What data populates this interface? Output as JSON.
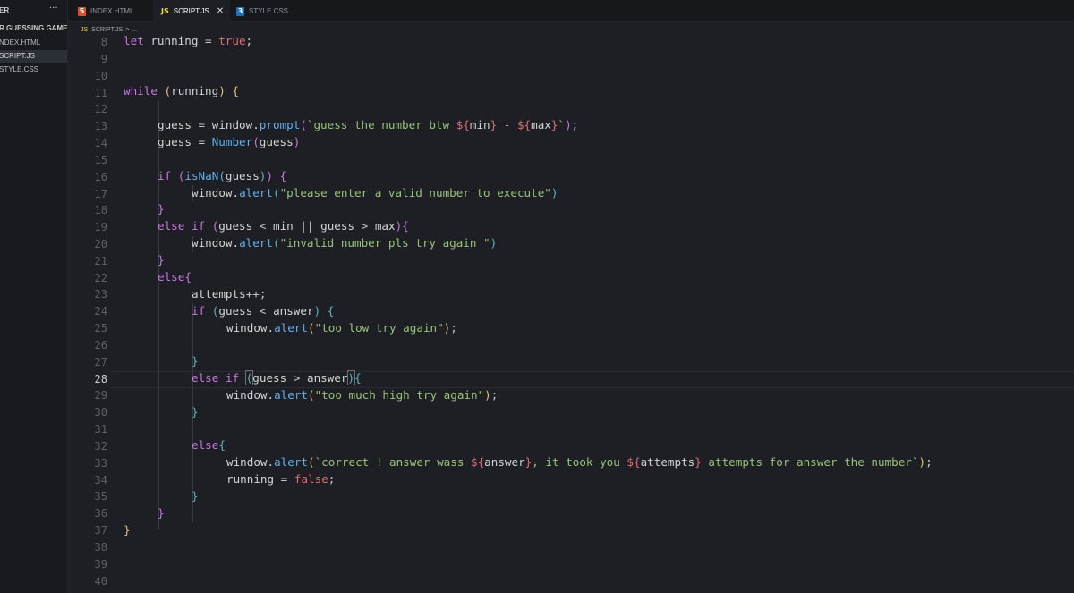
{
  "sidebar": {
    "title": "ER",
    "more": "···",
    "folder": "R GUESSING GAME",
    "files": [
      {
        "label": "NDEX.HTML",
        "active": false
      },
      {
        "label": "SCRIPT.JS",
        "active": true
      },
      {
        "label": "STYLE.CSS",
        "active": false
      }
    ]
  },
  "tabs": [
    {
      "label": "INDEX.HTML",
      "icon": "html-file-icon",
      "active": false
    },
    {
      "label": "SCRIPT.JS",
      "icon": "js-file-icon",
      "active": true
    },
    {
      "label": "STYLE.CSS",
      "icon": "css-file-icon",
      "active": false
    }
  ],
  "tab_close": "✕",
  "icon_text": {
    "html": "5",
    "css": "3",
    "js": "JS"
  },
  "breadcrumb": {
    "file": "SCRIPT.JS",
    "sep": ">",
    "more": "..."
  },
  "editor": {
    "current_line": "28",
    "line_numbers": [
      "8",
      "9",
      "10",
      "11",
      "12",
      "13",
      "14",
      "15",
      "16",
      "17",
      "18",
      "19",
      "20",
      "21",
      "22",
      "23",
      "24",
      "25",
      "26",
      "27",
      "28",
      "29",
      "30",
      "31",
      "32",
      "33",
      "34",
      "35",
      "36",
      "37",
      "38",
      "39",
      "40"
    ],
    "code": {
      "l8": {
        "k": "let",
        "v": "running",
        "eq": "=",
        "val": "true",
        "end": ";"
      },
      "l11": {
        "k": "while",
        "o": "(",
        "v": "running",
        "c": ")",
        "b": "{"
      },
      "l13": {
        "v": "guess",
        "eq": "=",
        "obj": "window.",
        "fn": "prompt",
        "o": "(",
        "s1": "`guess the number btw ",
        "d1": "${",
        "t1": "min",
        "e1": "}",
        "s2": " - ",
        "d2": "${",
        "t2": "max",
        "e2": "}",
        "s3": "`",
        "c": ")",
        "end": ";"
      },
      "l14": {
        "v": "guess",
        "eq": "=",
        "fn": "Number",
        "o": "(",
        "a": "guess",
        "c": ")"
      },
      "l16": {
        "k": "if",
        "o": "(",
        "fn": "isNaN",
        "o2": "(",
        "a": "guess",
        "c2": ")",
        "c": ")",
        "b": "{"
      },
      "l17": {
        "obj": "window.",
        "fn": "alert",
        "o": "(",
        "s": "\"please enter a valid number to execute\"",
        "c": ")"
      },
      "l18": {
        "b": "}"
      },
      "l19": {
        "k": "else",
        "k2": "if",
        "o": "(",
        "a": "guess",
        "lt": "<",
        "b1": "min",
        "or": "||",
        "a2": "guess",
        "gt": ">",
        "b2": "max",
        "c": ")",
        "b": "{"
      },
      "l20": {
        "obj": "window.",
        "fn": "alert",
        "o": "(",
        "s": "\"invalid number pls try again \"",
        "c": ")"
      },
      "l21": {
        "b": "}"
      },
      "l22": {
        "k": "else",
        "b": "{"
      },
      "l23": {
        "v": "attempts",
        "op": "++",
        "end": ";"
      },
      "l24": {
        "k": "if",
        "o": "(",
        "a": "guess",
        "lt": "<",
        "b1": "answer",
        "c": ")",
        "b": "{"
      },
      "l25": {
        "obj": "window.",
        "fn": "alert",
        "o": "(",
        "s": "\"too low try again\"",
        "c": ")",
        "end": ";"
      },
      "l27": {
        "b": "}"
      },
      "l28": {
        "k": "else",
        "k2": "if",
        "o": "(",
        "a": "guess",
        "gt": ">",
        "b1": "answer",
        "c": ")",
        "b": "{"
      },
      "l29": {
        "obj": "window.",
        "fn": "alert",
        "o": "(",
        "s": "\"too much high try again\"",
        "c": ")",
        "end": ";"
      },
      "l30": {
        "b": "}"
      },
      "l32": {
        "k": "else",
        "b": "{"
      },
      "l33": {
        "obj": "window.",
        "fn": "alert",
        "o": "(",
        "s1": "`correct ! answer wass ",
        "d1": "${",
        "t1": "answer",
        "e1": "}",
        "s2": ", it took you ",
        "d2": "${",
        "t2": "attempts",
        "e2": "}",
        "s3": " attempts for answer the number`",
        "c": ")",
        "end": ";"
      },
      "l34": {
        "v": "running",
        "eq": "=",
        "val": "false",
        "end": ";"
      },
      "l35": {
        "b": "}"
      },
      "l36": {
        "b": "}"
      },
      "l37": {
        "b": "}"
      }
    }
  },
  "colors": {
    "background": "#1e1f24",
    "keyword": "#c678dd",
    "string": "#98c379",
    "function": "#61afef",
    "boolean": "#e06c75",
    "bracket_gold": "#e5c07b",
    "bracket_purple": "#c678dd",
    "bracket_blue": "#56b6c2"
  }
}
